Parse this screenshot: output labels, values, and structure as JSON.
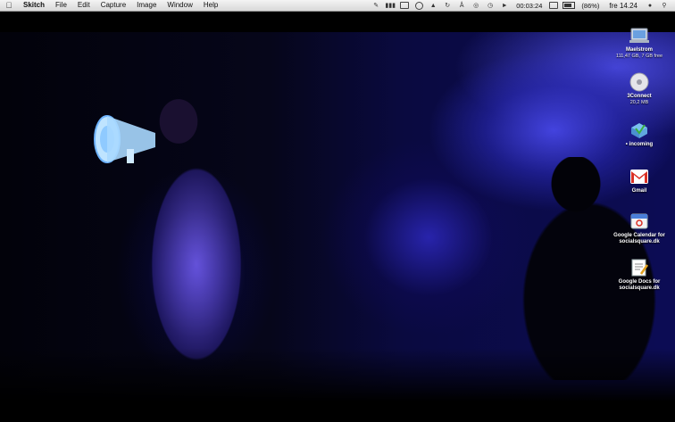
{
  "menubar": {
    "app_name": "Skitch",
    "menus": [
      "File",
      "Edit",
      "Capture",
      "Image",
      "Window",
      "Help"
    ],
    "timer": "00:03:24",
    "battery": "(86%)",
    "clock": "fre 14.24"
  },
  "desktop_icons": [
    {
      "label": "Maelstrom",
      "sub": "111,47 GB, 7 GB free",
      "icon": "hard-drive-icon"
    },
    {
      "label": "3Connect",
      "sub": "20,2 MB",
      "icon": "disc-icon"
    },
    {
      "label": "• incoming",
      "sub": "",
      "icon": "folder-icon"
    },
    {
      "label": "Gmail",
      "sub": "",
      "icon": "gmail-icon"
    },
    {
      "label": "Google Calendar for",
      "sub": "socialsquare.dk",
      "icon": "calendar-icon"
    },
    {
      "label": "Google Docs for",
      "sub": "socialsquare.dk",
      "icon": "docs-icon"
    }
  ],
  "colors": {
    "menubar_bg": "#e6e6e6",
    "desktop_bg": "#000000",
    "stage_blue": "#3c3cdc"
  }
}
